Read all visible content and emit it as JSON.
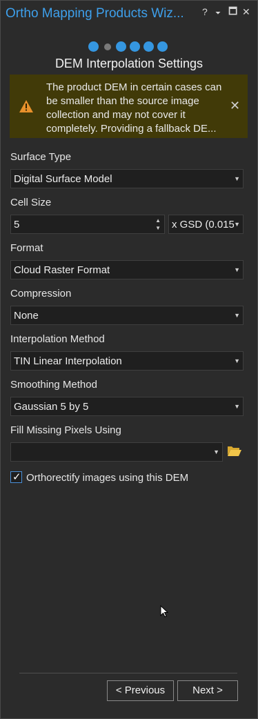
{
  "window": {
    "title": "Ortho Mapping Products Wiz...",
    "help_label": "?",
    "pin_label": "⏷",
    "restore_label": "🗖",
    "close_label": "✕"
  },
  "steps": {
    "count": 6,
    "current": 2
  },
  "page_title": "DEM Interpolation Settings",
  "warning": {
    "text": "The product DEM in certain cases can be smaller than the source image collection and may not cover it completely. Providing a fallback DE...",
    "icon": "warning-icon",
    "close_label": "✕"
  },
  "fields": {
    "surface_type": {
      "label": "Surface Type",
      "value": "Digital Surface Model"
    },
    "cell_size": {
      "label": "Cell Size",
      "value": "5",
      "unit": "x GSD (0.015:"
    },
    "format": {
      "label": "Format",
      "value": "Cloud Raster Format"
    },
    "compression": {
      "label": "Compression",
      "value": "None"
    },
    "interpolation": {
      "label": "Interpolation Method",
      "value": "TIN Linear Interpolation"
    },
    "smoothing": {
      "label": "Smoothing Method",
      "value": "Gaussian 5 by 5"
    },
    "fill_missing": {
      "label": "Fill Missing Pixels Using",
      "value": ""
    }
  },
  "orthorectify": {
    "label": "Orthorectify images using this DEM",
    "checked": true
  },
  "buttons": {
    "previous": "< Previous",
    "next": "Next >"
  },
  "colors": {
    "accent": "#3596e0",
    "warning_bg": "#413a08",
    "warning_icon": "#e8912b"
  }
}
